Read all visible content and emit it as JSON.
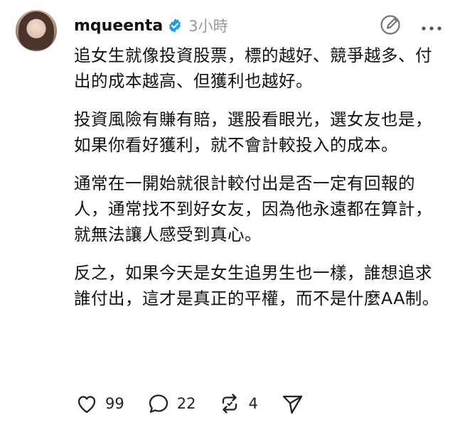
{
  "post": {
    "username": "mqueenta",
    "time": "3小時",
    "paragraphs": [
      "追女生就像投資股票，標的越好、競爭越多、付出的成本越高、但獲利也越好。",
      "投資風險有賺有賠，選股看眼光，選女友也是，如果你看好獲利，就不會計較投入的成本。",
      "通常在一開始就很計較付出是否一定有回報的人，通常找不到好女友，因為他永遠都在算計，就無法讓人感受到真心。",
      "反之，如果今天是女生追男生也一樣，誰想追求誰付出，這才是真正的平權，而不是什麼AA制。"
    ],
    "actions": {
      "likes": "99",
      "comments": "22",
      "reposts": "4"
    }
  },
  "icons": {
    "verified": "verified-badge-icon",
    "edit": "edit-icon",
    "more": "more-icon",
    "like": "heart-icon",
    "comment": "comment-icon",
    "repost": "repost-icon",
    "share": "send-icon"
  },
  "colors": {
    "verified": "#1d9bf0",
    "text": "#111111",
    "muted": "#999999"
  }
}
